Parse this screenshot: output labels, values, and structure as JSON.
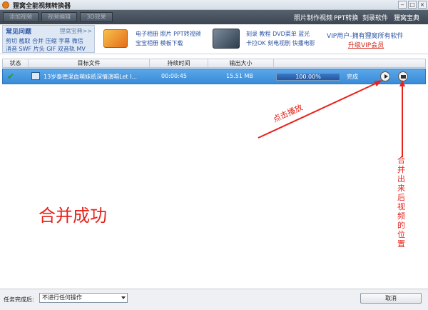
{
  "window": {
    "title": "狸窝全能视频转换器",
    "controls": [
      "‒",
      "□",
      "×"
    ]
  },
  "toolbar": {
    "disabled_buttons": [
      "添加视频",
      "视频编辑",
      "3D效果"
    ],
    "links": [
      "照片制作视频",
      "PPT转换",
      "刻录软件",
      "狸窝宝典"
    ]
  },
  "faq": {
    "title": "常见问题",
    "more": "狸窝宝典>>",
    "line1": "剪切 截取 合并 压缩 字幕 微信",
    "line2": "消音 SWF 片头 GIF 双音轨 MV"
  },
  "promo": {
    "p1_line1": "电子相册 照片 PPT转视频",
    "p1_line2": "宝宝相册 模板下载",
    "p2_line1": "刻录 教程 DVD菜单 蓝光",
    "p2_line2": "卡拉OK 刻电视剧 快播电影",
    "vip_line1": "VIP用户-拥有狸窝所有软件",
    "vip_line2": "升级VIP会员"
  },
  "table": {
    "columns": [
      "状态",
      "目标文件",
      "持续时间",
      "输出大小"
    ],
    "row": {
      "file": "13岁泰德混血萌妹纸深情演唱Let I...",
      "duration": "00:00:45",
      "size": "15.51 MB",
      "progress_label": "100.00%",
      "progress": 1.0,
      "status": "完成"
    }
  },
  "annotations": {
    "play_hint": "点击播放",
    "merge_success": "合并成功",
    "location_hint": "合并出来后视频的位置"
  },
  "bottom": {
    "after_task_label": "任务完成后:",
    "after_task_value": "不进行任何操作",
    "cancel_label": "取消"
  },
  "colors": {
    "annotation": "#e8231b",
    "row_selected": "#3a8bd8"
  }
}
